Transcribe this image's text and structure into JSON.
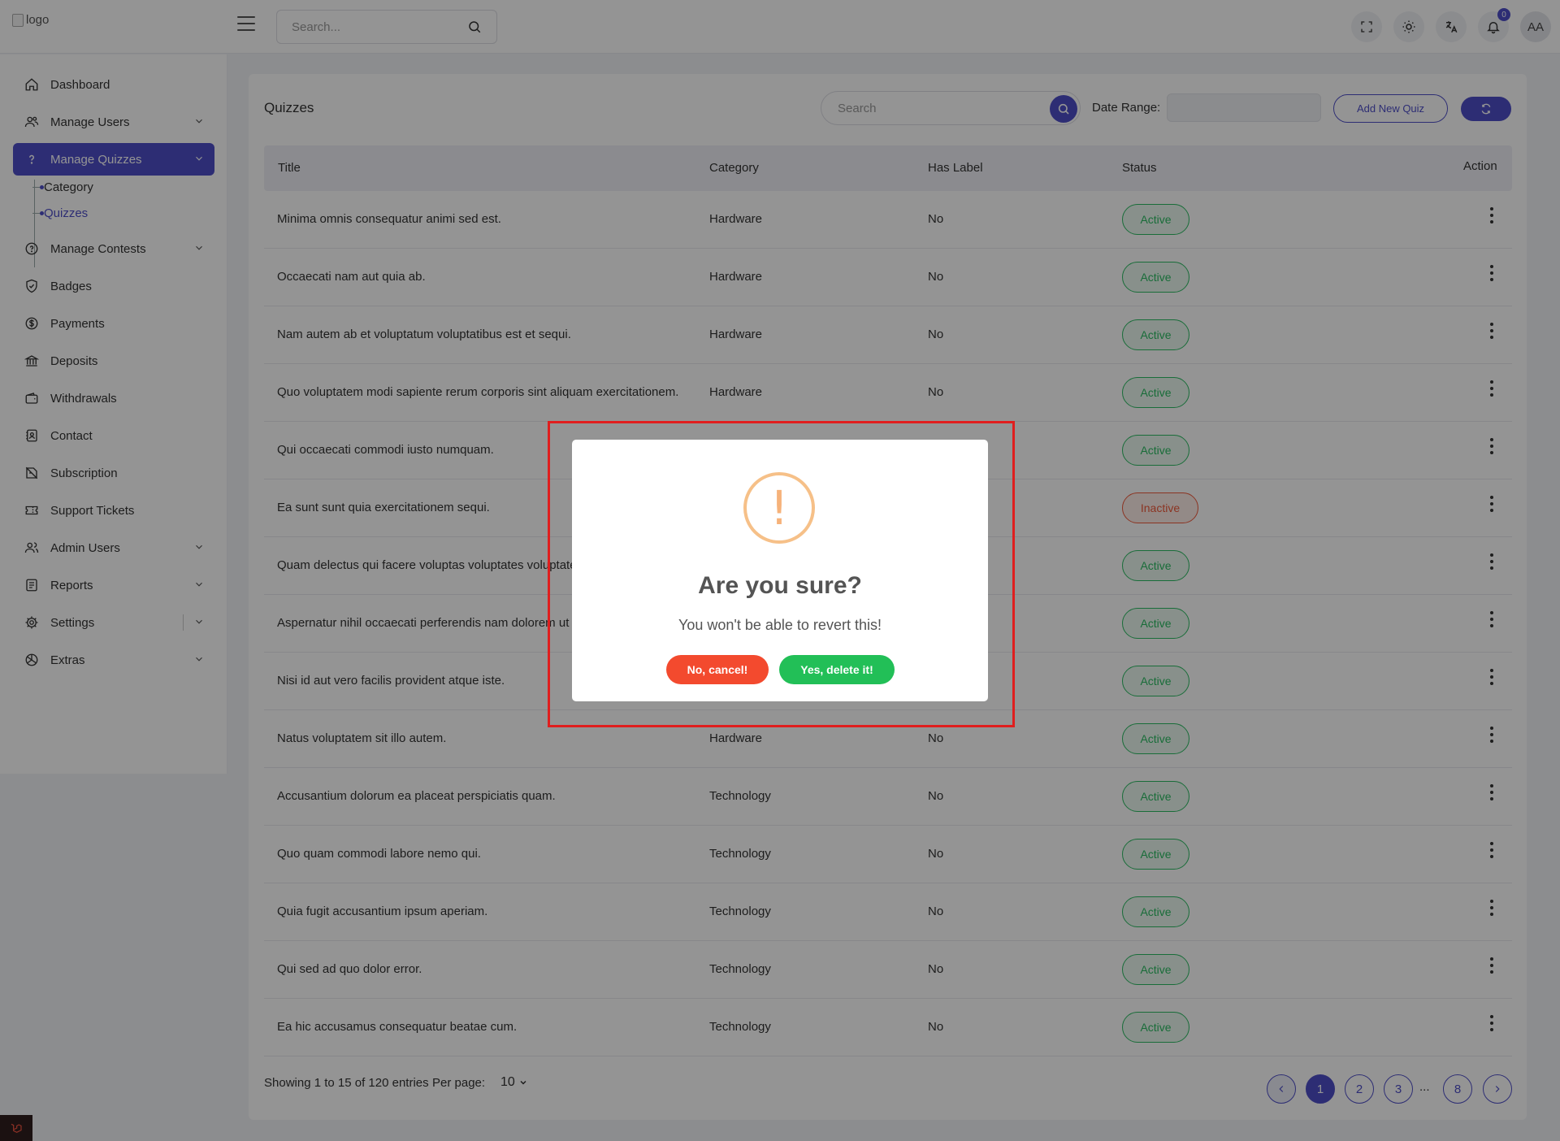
{
  "header": {
    "logo_alt": "logo",
    "search_placeholder": "Search...",
    "notification_count": "0",
    "avatar_initials": "AA"
  },
  "sidebar": {
    "items": [
      {
        "label": "Dashboard",
        "icon": "home-icon"
      },
      {
        "label": "Manage Users",
        "icon": "users-icon"
      },
      {
        "label": "Manage Quizzes",
        "icon": "question-icon"
      },
      {
        "label": "Manage Contests",
        "icon": "contest-icon"
      },
      {
        "label": "Badges",
        "icon": "badge-icon"
      },
      {
        "label": "Payments",
        "icon": "dollar-icon"
      },
      {
        "label": "Deposits",
        "icon": "bank-icon"
      },
      {
        "label": "Withdrawals",
        "icon": "wallet-icon"
      },
      {
        "label": "Contact",
        "icon": "contact-book-icon"
      },
      {
        "label": "Subscription",
        "icon": "subscription-icon"
      },
      {
        "label": "Support Tickets",
        "icon": "ticket-icon"
      },
      {
        "label": "Admin Users",
        "icon": "admin-users-icon"
      },
      {
        "label": "Reports",
        "icon": "report-icon"
      },
      {
        "label": "Settings",
        "icon": "gear-icon"
      },
      {
        "label": "Extras",
        "icon": "extras-icon"
      }
    ],
    "quiz_sub": [
      "Category",
      "Quizzes"
    ]
  },
  "page": {
    "title": "Quizzes",
    "search_placeholder": "Search",
    "date_range_label": "Date Range:",
    "add_button": "Add New Quiz"
  },
  "table": {
    "headers": [
      "Title",
      "Category",
      "Has Label",
      "Status",
      "Action"
    ],
    "rows": [
      {
        "title": "Minima omnis consequatur animi sed est.",
        "category": "Hardware",
        "has_label": "No",
        "status": "Active"
      },
      {
        "title": "Occaecati nam aut quia ab.",
        "category": "Hardware",
        "has_label": "No",
        "status": "Active"
      },
      {
        "title": "Nam autem ab et voluptatum voluptatibus est et sequi.",
        "category": "Hardware",
        "has_label": "No",
        "status": "Active"
      },
      {
        "title": "Quo voluptatem modi sapiente rerum corporis sint aliquam exercitationem.",
        "category": "Hardware",
        "has_label": "No",
        "status": "Active"
      },
      {
        "title": "Qui occaecati commodi iusto numquam.",
        "category": "",
        "has_label": "",
        "status": "Active"
      },
      {
        "title": "Ea sunt sunt quia exercitationem sequi.",
        "category": "",
        "has_label": "",
        "status": "Inactive"
      },
      {
        "title": "Quam delectus qui facere voluptas voluptates voluptate",
        "category": "",
        "has_label": "",
        "status": "Active"
      },
      {
        "title": "Aspernatur nihil occaecati perferendis nam dolorem ut",
        "category": "",
        "has_label": "",
        "status": "Active"
      },
      {
        "title": "Nisi id aut vero facilis provident atque iste.",
        "category": "",
        "has_label": "",
        "status": "Active"
      },
      {
        "title": "Natus voluptatem sit illo autem.",
        "category": "Hardware",
        "has_label": "No",
        "status": "Active"
      },
      {
        "title": "Accusantium dolorum ea placeat perspiciatis quam.",
        "category": "Technology",
        "has_label": "No",
        "status": "Active"
      },
      {
        "title": "Quo quam commodi labore nemo qui.",
        "category": "Technology",
        "has_label": "No",
        "status": "Active"
      },
      {
        "title": "Quia fugit accusantium ipsum aperiam.",
        "category": "Technology",
        "has_label": "No",
        "status": "Active"
      },
      {
        "title": "Qui sed ad quo dolor error.",
        "category": "Technology",
        "has_label": "No",
        "status": "Active"
      },
      {
        "title": "Ea hic accusamus consequatur beatae cum.",
        "category": "Technology",
        "has_label": "No",
        "status": "Active"
      }
    ]
  },
  "footer": {
    "info": "Showing 1 to 15 of 120 entries",
    "per_page_label": "Per page:",
    "per_page_value": "10",
    "pages": [
      "1",
      "2",
      "3",
      "8"
    ],
    "ellipsis": "..."
  },
  "modal": {
    "icon": "!",
    "title": "Are you sure?",
    "text": "You won't be able to revert this!",
    "cancel": "No, cancel!",
    "confirm": "Yes, delete it!"
  },
  "colors": {
    "primary": "#4f4fc8",
    "active": "#2cbc63",
    "inactive": "#f05a3c",
    "cancel": "#f34a2e",
    "confirm": "#22bf57",
    "warning": "#f6c088",
    "highlight": "#e01e1e"
  }
}
